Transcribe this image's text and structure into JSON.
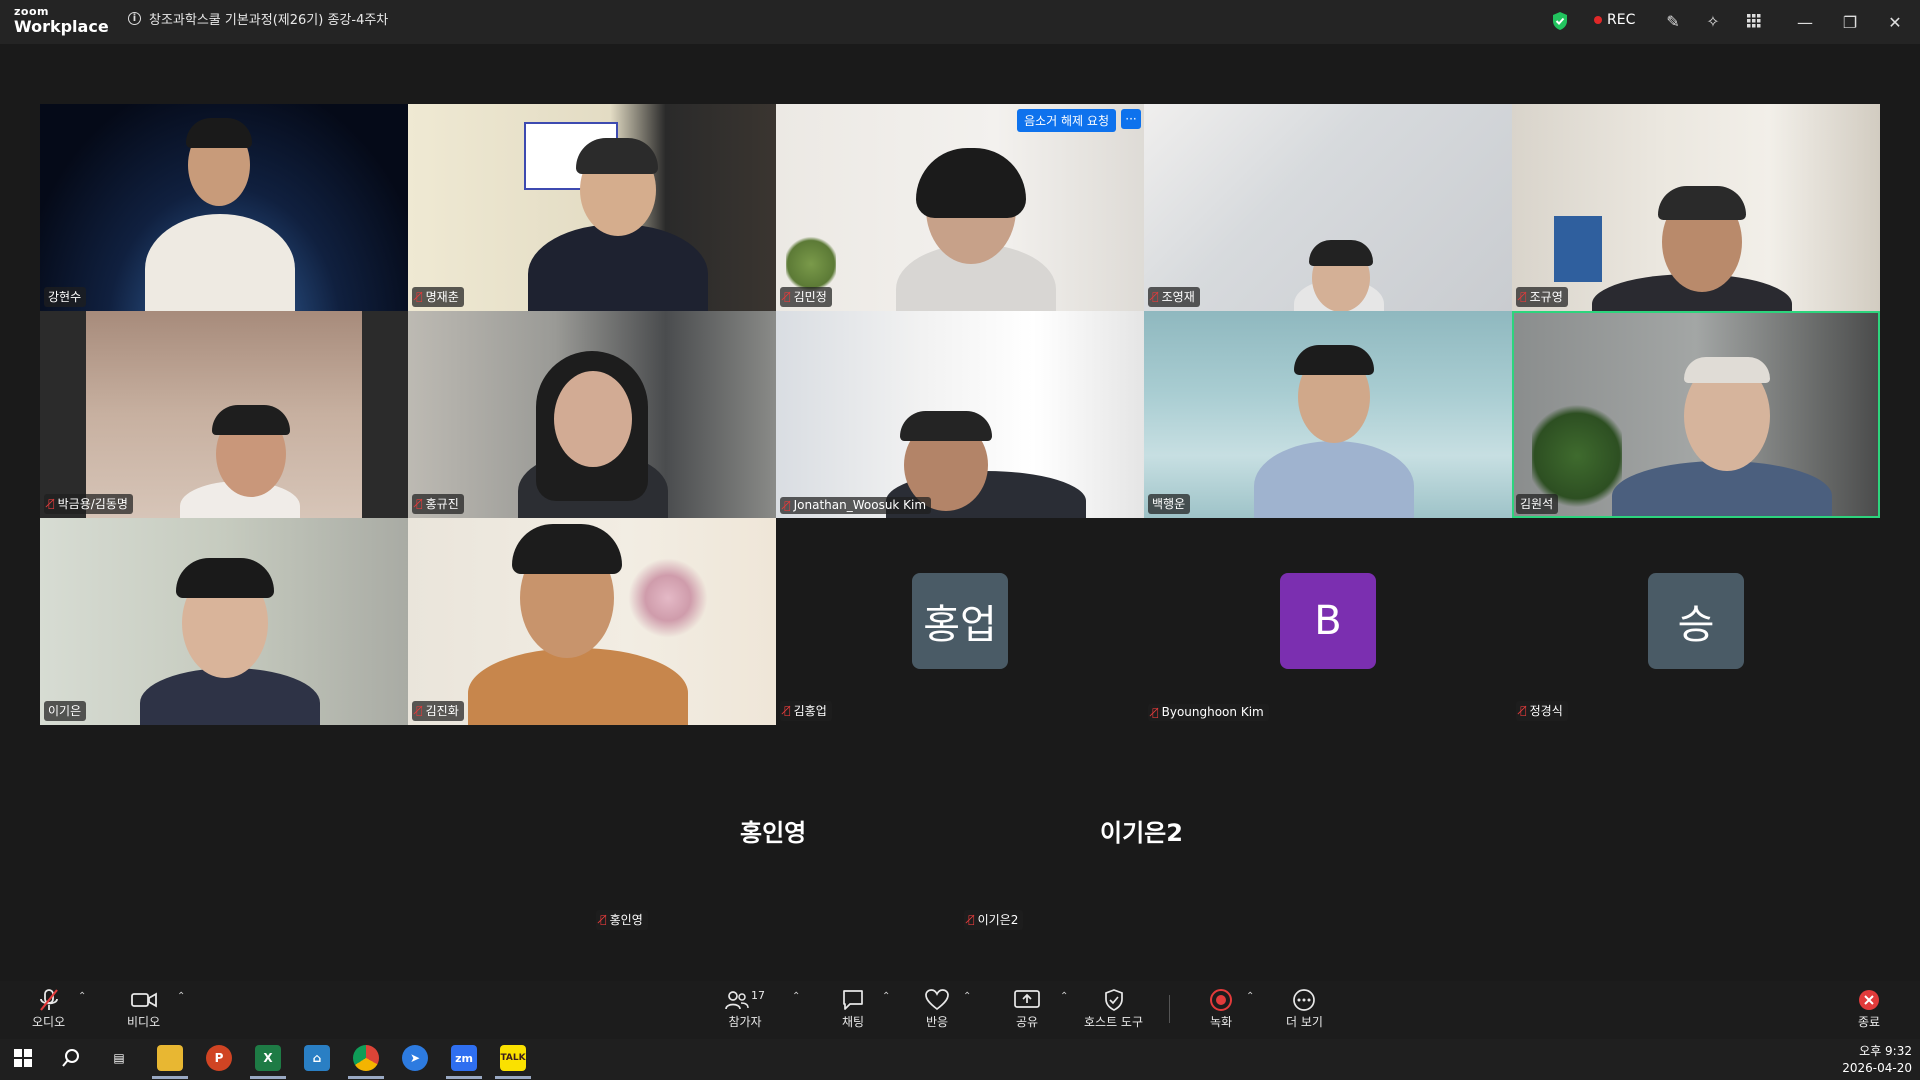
{
  "app": {
    "logo_small": "zoom",
    "logo_big": "Workplace",
    "meeting_title": "창조과학스쿨 기본과정(제26기) 종강-4주차"
  },
  "titlebar": {
    "rec_label": "REC"
  },
  "tiles": [
    {
      "name": "강현수",
      "muted": false
    },
    {
      "name": "명재춘",
      "muted": true
    },
    {
      "name": "김민정",
      "muted": true
    },
    {
      "name": "조영재",
      "muted": true
    },
    {
      "name": "조규영",
      "muted": true
    },
    {
      "name": "박금용/김동명",
      "muted": true
    },
    {
      "name": "홍규진",
      "muted": true
    },
    {
      "name": "Jonathan_Woosuk Kim",
      "muted": true
    },
    {
      "name": "백행운",
      "muted": false
    },
    {
      "name": "김원석",
      "muted": false
    },
    {
      "name": "이기은",
      "muted": false
    },
    {
      "name": "김진화",
      "muted": true
    },
    {
      "name": "김홍업",
      "muted": true,
      "avatar": "홍업",
      "avatar_color": "#4a5b66"
    },
    {
      "name": "Byounghoon Kim",
      "muted": true,
      "avatar": "B",
      "avatar_color": "#7b2fb0"
    },
    {
      "name": "정경식",
      "muted": true,
      "avatar": "승",
      "avatar_color": "#4a5b66"
    }
  ],
  "unmute_request": "음소거 해제 요청",
  "more_dots": "···",
  "audio_only": [
    {
      "display": "홍인영",
      "name": "홍인영"
    },
    {
      "display": "이기은2",
      "name": "이기은2"
    }
  ],
  "controls": {
    "audio": "오디오",
    "video": "비디오",
    "participants": "참가자",
    "participants_count": "17",
    "chat": "채팅",
    "reactions": "반응",
    "share": "공유",
    "host_tools": "호스트 도구",
    "record": "녹화",
    "more": "더 보기",
    "end": "종료"
  },
  "taskbar": {
    "time": "오후 9:32",
    "date": "2026-04-20"
  },
  "colors": {
    "active_speaker": "#2dd47d",
    "accent": "#0e72ed",
    "mute_red": "#e23b3b"
  }
}
